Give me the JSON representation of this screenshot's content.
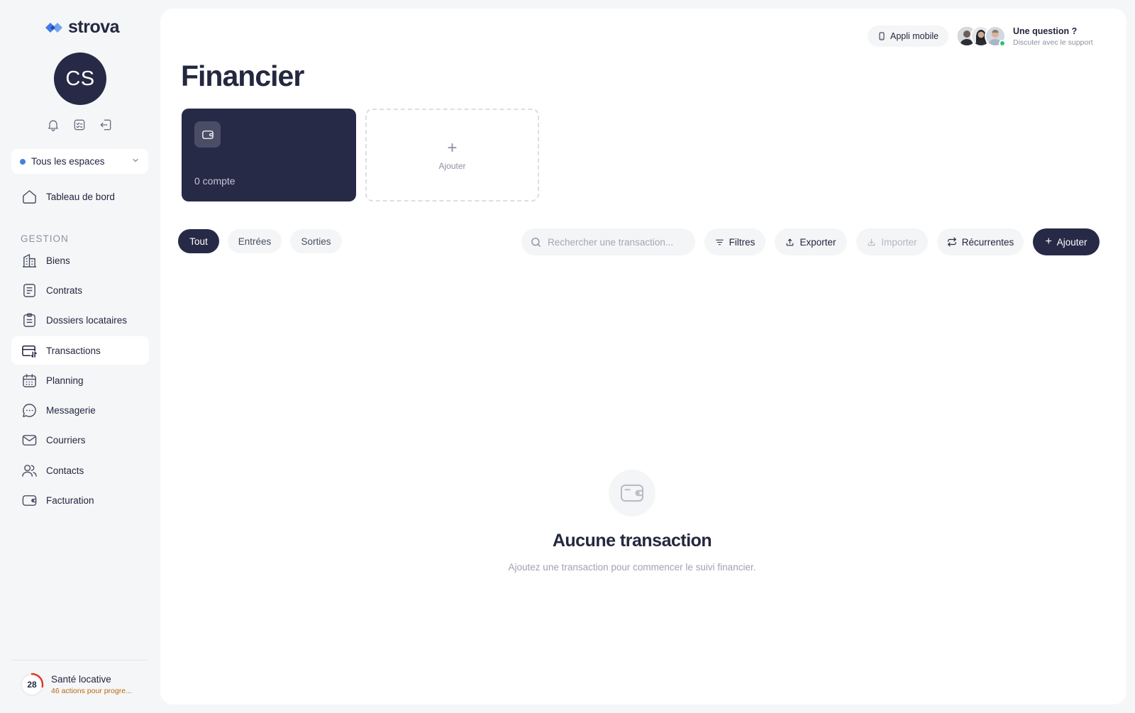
{
  "app": {
    "logo_text": "strova",
    "user_initials": "CS"
  },
  "sidebar": {
    "space_selector": {
      "label": "Tous les espaces"
    },
    "dashboard": {
      "label": "Tableau de bord"
    },
    "section_title": "GESTION",
    "items": [
      {
        "label": "Biens",
        "icon": "building-icon"
      },
      {
        "label": "Contrats",
        "icon": "document-icon"
      },
      {
        "label": "Dossiers locataires",
        "icon": "clipboard-icon"
      },
      {
        "label": "Transactions",
        "icon": "transactions-icon",
        "active": true
      },
      {
        "label": "Planning",
        "icon": "calendar-icon"
      },
      {
        "label": "Messagerie",
        "icon": "chat-icon"
      },
      {
        "label": "Courriers",
        "icon": "mail-icon"
      },
      {
        "label": "Contacts",
        "icon": "contacts-icon"
      },
      {
        "label": "Facturation",
        "icon": "wallet-icon"
      }
    ],
    "health": {
      "score": "28",
      "title": "Santé locative",
      "subtitle": "46 actions pour progre..."
    }
  },
  "header": {
    "app_button": "Appli mobile",
    "support_title": "Une question ?",
    "support_subtitle": "Discuter avec le support"
  },
  "main": {
    "title": "Financier",
    "account_card": {
      "count_label": "0 compte"
    },
    "add_card": {
      "label": "Ajouter"
    },
    "tabs": [
      {
        "label": "Tout",
        "active": true
      },
      {
        "label": "Entrées"
      },
      {
        "label": "Sorties"
      }
    ],
    "search": {
      "placeholder": "Rechercher une transaction..."
    },
    "actions": {
      "filters": "Filtres",
      "export": "Exporter",
      "import": "Importer",
      "recurring": "Récurrentes",
      "add": "Ajouter"
    },
    "empty": {
      "title": "Aucune transaction",
      "subtitle": "Ajoutez une transaction pour commencer le suivi financier."
    }
  },
  "colors": {
    "navy": "#272a47",
    "accent_blue": "#4a7ee6",
    "online": "#2cc36b",
    "health_red": "#d93a2b",
    "health_orange": "#b86a10"
  }
}
